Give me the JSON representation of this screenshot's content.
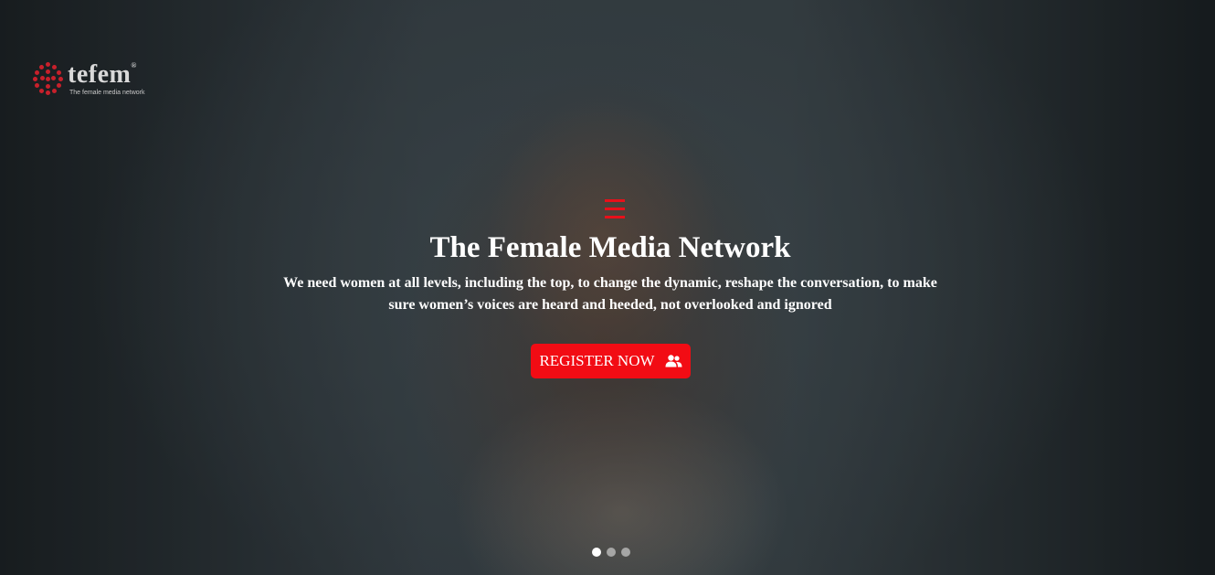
{
  "logo": {
    "word": "tefem",
    "registered": "®",
    "tagline": "The female media network"
  },
  "hero": {
    "title": "The Female Media Network",
    "subtitle": "We need women at all levels, including the top, to change the dynamic, reshape the conversation, to make sure women’s voices are heard and heeded, not overlooked and ignored",
    "cta_label": "REGISTER NOW",
    "cta_icon": "users-icon"
  },
  "carousel": {
    "slide_count": 3,
    "active_index": 0
  },
  "colors": {
    "accent": "#f20c14",
    "logo_red": "#c8202b"
  }
}
